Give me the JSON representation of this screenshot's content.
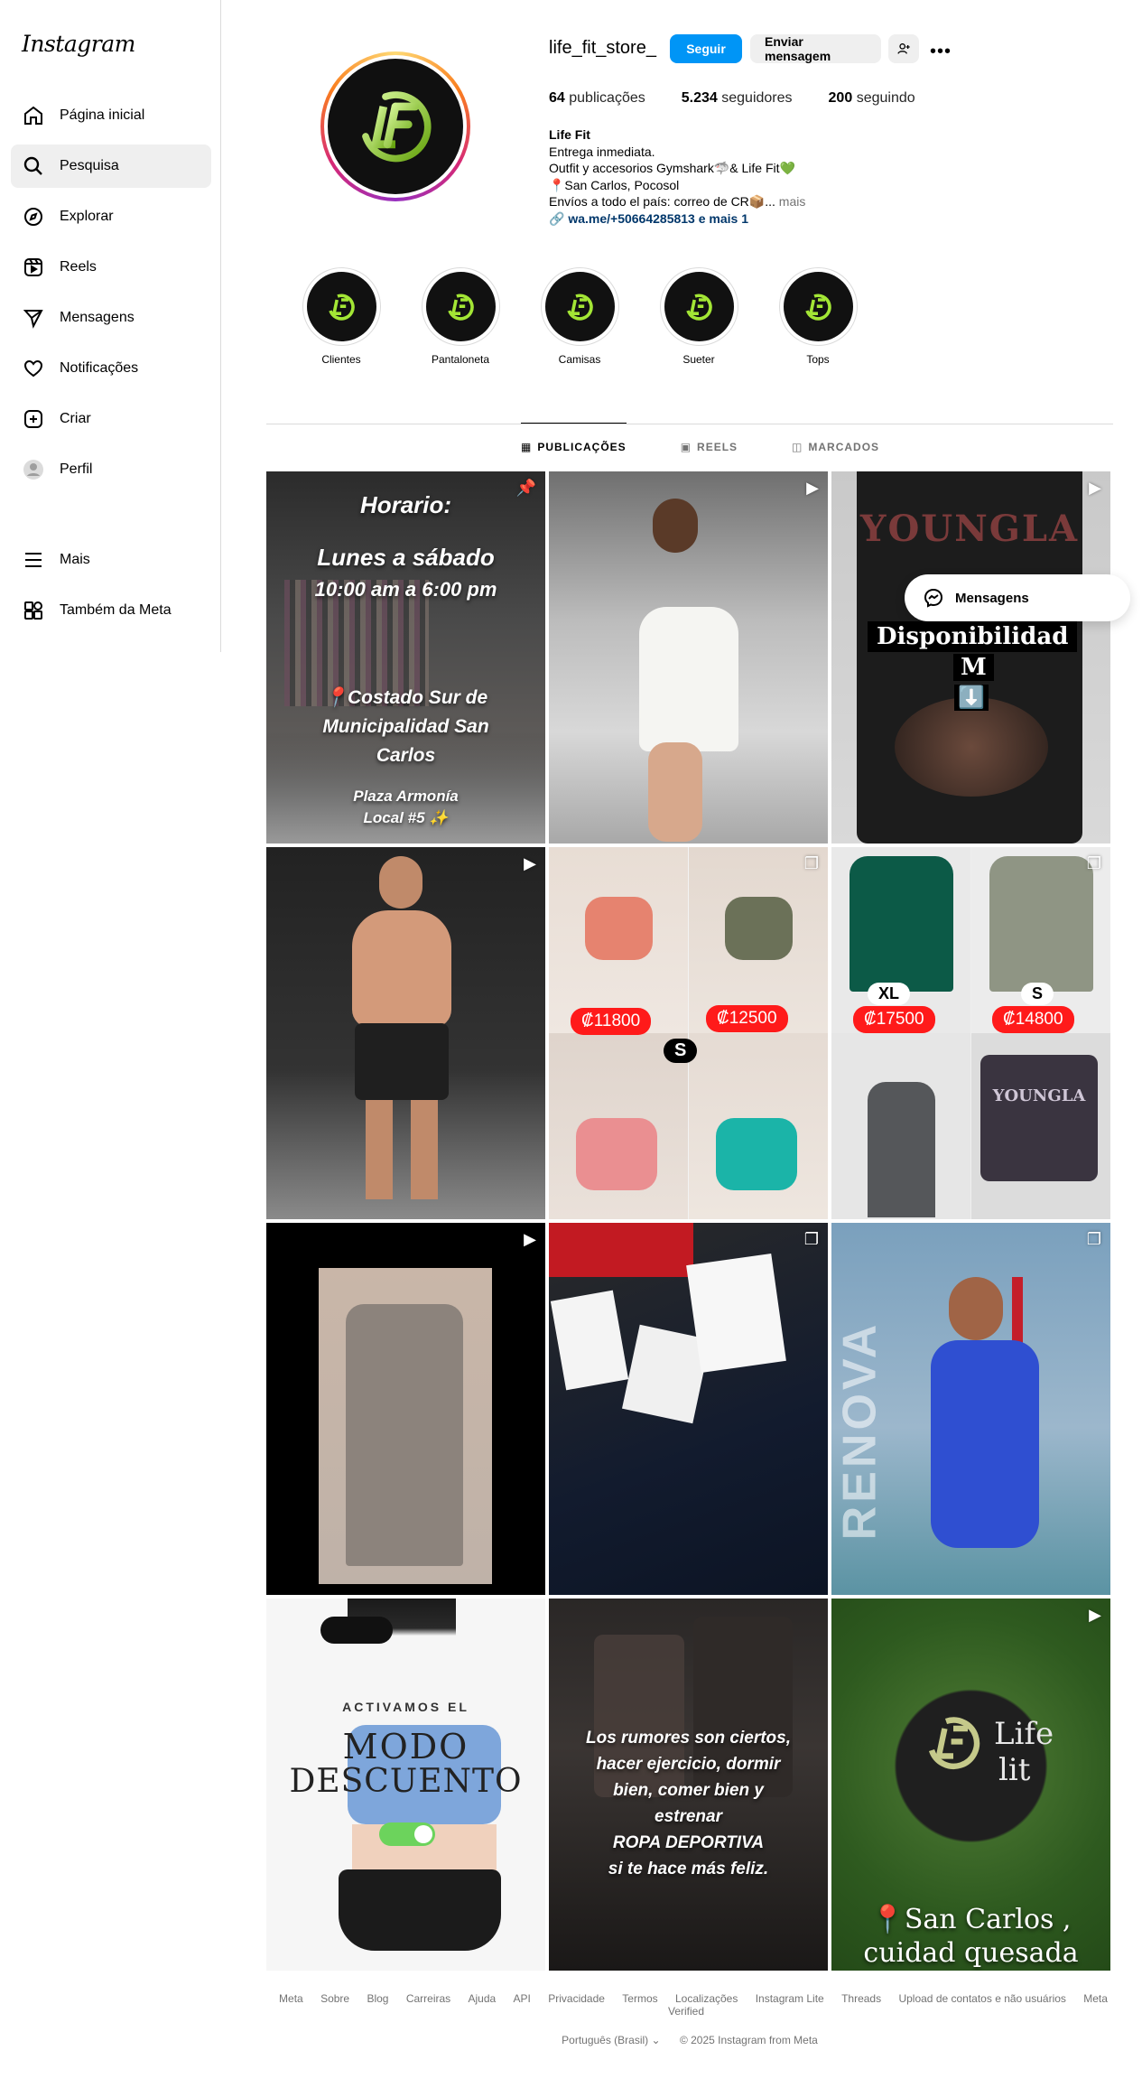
{
  "app": {
    "logo": "Instagram"
  },
  "sidebar": {
    "items": [
      {
        "label": "Página inicial",
        "icon": "home-icon"
      },
      {
        "label": "Pesquisa",
        "icon": "search-icon"
      },
      {
        "label": "Explorar",
        "icon": "compass-icon"
      },
      {
        "label": "Reels",
        "icon": "reels-icon"
      },
      {
        "label": "Mensagens",
        "icon": "send-icon"
      },
      {
        "label": "Notificações",
        "icon": "heart-icon"
      },
      {
        "label": "Criar",
        "icon": "plus-square-icon"
      },
      {
        "label": "Perfil",
        "icon": "avatar-icon"
      }
    ],
    "bottom": [
      {
        "label": "Mais",
        "icon": "menu-icon"
      },
      {
        "label": "Também da Meta",
        "icon": "meta-apps-icon"
      }
    ]
  },
  "profile": {
    "username": "life_fit_store_",
    "follow_label": "Seguir",
    "message_label": "Enviar mensagem",
    "stats": {
      "posts": "64",
      "posts_label": "publicações",
      "followers": "5.234",
      "followers_label": "seguidores",
      "following": "200",
      "following_label": "seguindo"
    },
    "bio": {
      "name": "Life Fit",
      "line1": "Entrega inmediata.",
      "line2": "Outfit y accesorios Gymshark🦈& Life Fit💚",
      "line3": "📍San Carlos, Pocosol",
      "line4": "Envíos a todo el país: correo de CR📦...",
      "more": "mais",
      "link": "wa.me/+50664285813 e mais 1"
    }
  },
  "highlights": [
    {
      "label": "Clientes"
    },
    {
      "label": "Pantaloneta"
    },
    {
      "label": "Camisas"
    },
    {
      "label": "Sueter"
    },
    {
      "label": "Tops"
    }
  ],
  "tabs": [
    {
      "label": "PUBLICAÇÕES"
    },
    {
      "label": "REELS"
    },
    {
      "label": "MARCADOS"
    }
  ],
  "posts": {
    "p1": {
      "title": "Horario:",
      "days": "Lunes a sábado",
      "hours": "10:00 am a 6:00 pm",
      "location": "📍Costado Sur de Municipalidad San Carlos",
      "plaza": "Plaza Armonía",
      "local": "Local #5 ✨"
    },
    "p3": {
      "title": "Disponibilidad",
      "size": "M",
      "arrow": "⬇️",
      "brand": "YOUNGLA"
    },
    "p5": {
      "price1": "₡11800",
      "price2": "₡12500",
      "size": "S"
    },
    "p6": {
      "size1": "XL",
      "size2": "S",
      "price1": "₡17500",
      "price2": "₡14800",
      "brand": "YOUNGLA"
    },
    "p9": {
      "wall_text": "RENOVA"
    },
    "p10": {
      "small": "ACTIVAMOS EL",
      "big1": "MODO",
      "big2": "DESCUENTO"
    },
    "p11": {
      "l1": "Los rumores son ciertos,",
      "l2": "hacer ejercicio, dormir",
      "l3": "bien, comer bien y",
      "l4": "estrenar",
      "l5": "ROPA DEPORTIVA",
      "l6": "si te hace más feliz."
    },
    "p12": {
      "brand1": "Life",
      "brand2": "lit",
      "loc1": "📍San Carlos ,",
      "loc2": "cuidad quesada"
    }
  },
  "floating": {
    "messages_label": "Mensagens"
  },
  "footer": {
    "links": [
      "Meta",
      "Sobre",
      "Blog",
      "Carreiras",
      "Ajuda",
      "API",
      "Privacidade",
      "Termos",
      "Localizações",
      "Instagram Lite",
      "Threads",
      "Upload de contatos e não usuários",
      "Meta Verified"
    ],
    "language": "Português (Brasil)",
    "copyright": "© 2025 Instagram from Meta"
  },
  "colors": {
    "accent": "#0095f6",
    "brand_green": "#a3e635",
    "price_red": "#ff1a1a"
  }
}
